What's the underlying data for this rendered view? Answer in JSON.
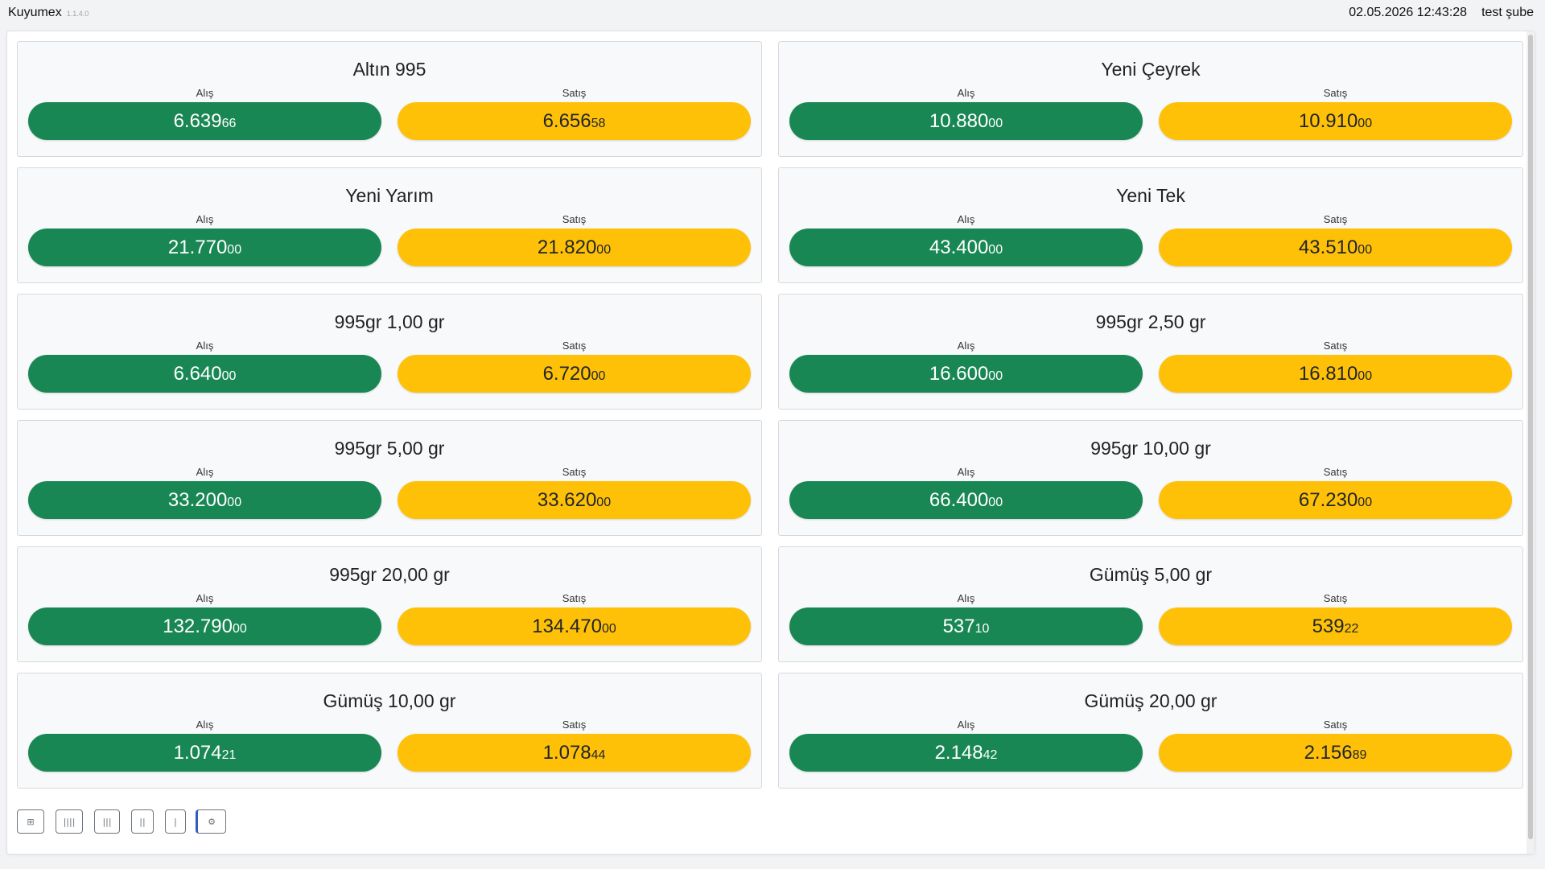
{
  "header": {
    "app_name": "Kuyumex",
    "version": "1.1.4.0",
    "datetime": "02.05.2026 12:43:28",
    "branch": "test şube"
  },
  "labels": {
    "buy": "Alış",
    "sell": "Satış"
  },
  "colors": {
    "buy": "#198754",
    "sell": "#ffc107"
  },
  "cards": [
    {
      "title": "Altın 995",
      "buy_int": "6.639",
      "buy_dec": "66",
      "sell_int": "6.656",
      "sell_dec": "58"
    },
    {
      "title": "Yeni Çeyrek",
      "buy_int": "10.880",
      "buy_dec": "00",
      "sell_int": "10.910",
      "sell_dec": "00"
    },
    {
      "title": "Yeni Yarım",
      "buy_int": "21.770",
      "buy_dec": "00",
      "sell_int": "21.820",
      "sell_dec": "00"
    },
    {
      "title": "Yeni Tek",
      "buy_int": "43.400",
      "buy_dec": "00",
      "sell_int": "43.510",
      "sell_dec": "00"
    },
    {
      "title": "995gr 1,00 gr",
      "buy_int": "6.640",
      "buy_dec": "00",
      "sell_int": "6.720",
      "sell_dec": "00"
    },
    {
      "title": "995gr 2,50 gr",
      "buy_int": "16.600",
      "buy_dec": "00",
      "sell_int": "16.810",
      "sell_dec": "00"
    },
    {
      "title": "995gr 5,00 gr",
      "buy_int": "33.200",
      "buy_dec": "00",
      "sell_int": "33.620",
      "sell_dec": "00"
    },
    {
      "title": "995gr 10,00 gr",
      "buy_int": "66.400",
      "buy_dec": "00",
      "sell_int": "67.230",
      "sell_dec": "00"
    },
    {
      "title": "995gr 20,00 gr",
      "buy_int": "132.790",
      "buy_dec": "00",
      "sell_int": "134.470",
      "sell_dec": "00"
    },
    {
      "title": "Gümüş 5,00 gr",
      "buy_int": "537",
      "buy_dec": "10",
      "sell_int": "539",
      "sell_dec": "22"
    },
    {
      "title": "Gümüş 10,00 gr",
      "buy_int": "1.074",
      "buy_dec": "21",
      "sell_int": "1.078",
      "sell_dec": "44"
    },
    {
      "title": "Gümüş 20,00 gr",
      "buy_int": "2.148",
      "buy_dec": "42",
      "sell_int": "2.156",
      "sell_dec": "89"
    }
  ],
  "toolbar": {
    "buttons": [
      {
        "icon": "grid-icon",
        "glyph": "⊞"
      },
      {
        "icon": "four-columns-icon",
        "glyph": "||||"
      },
      {
        "icon": "three-columns-icon",
        "glyph": "|||"
      },
      {
        "icon": "two-columns-icon",
        "glyph": "||"
      },
      {
        "icon": "one-column-icon",
        "glyph": "|"
      },
      {
        "icon": "settings-icon",
        "glyph": "⚙"
      }
    ]
  }
}
